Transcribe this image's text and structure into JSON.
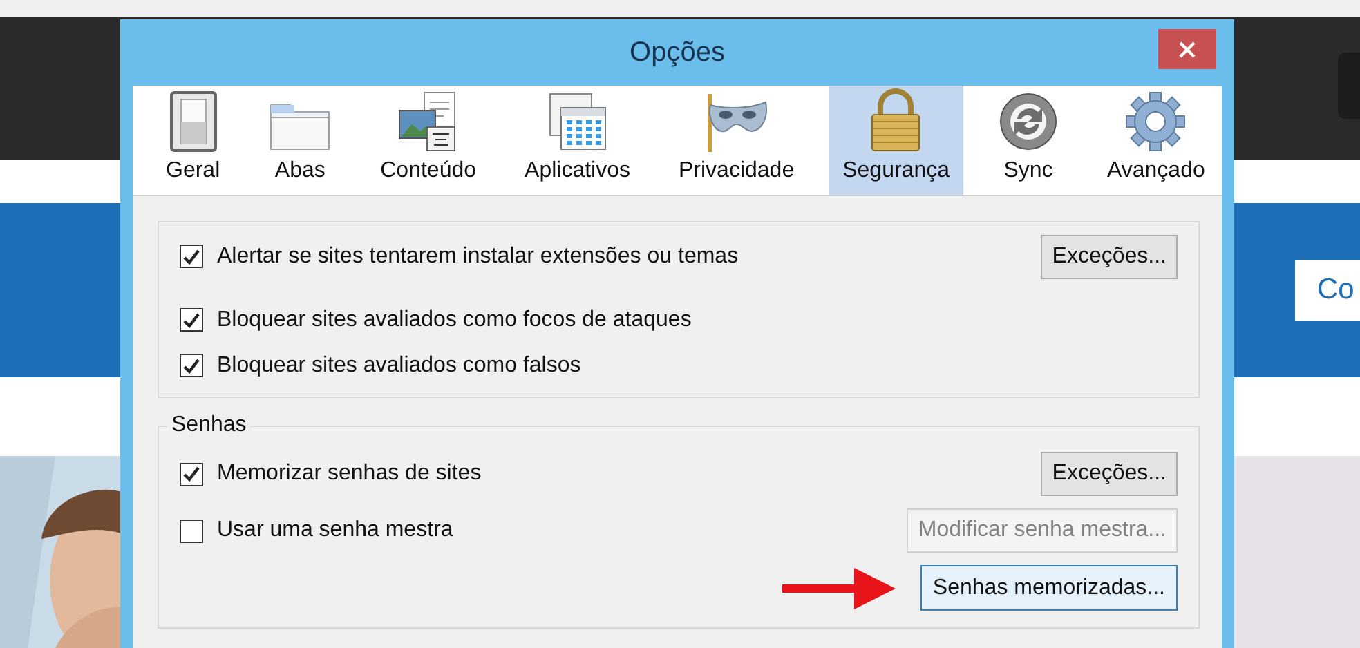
{
  "background": {
    "side_button": "Co"
  },
  "dialog": {
    "title": "Opções",
    "tabs": [
      {
        "label": "Geral",
        "kind": "general",
        "selected": false
      },
      {
        "label": "Abas",
        "kind": "tabs",
        "selected": false
      },
      {
        "label": "Conteúdo",
        "kind": "content",
        "selected": false
      },
      {
        "label": "Aplicativos",
        "kind": "applications",
        "selected": false
      },
      {
        "label": "Privacidade",
        "kind": "privacy",
        "selected": false
      },
      {
        "label": "Segurança",
        "kind": "security",
        "selected": true
      },
      {
        "label": "Sync",
        "kind": "sync",
        "selected": false
      },
      {
        "label": "Avançado",
        "kind": "advanced",
        "selected": false
      }
    ],
    "security_group": {
      "rows": [
        {
          "label": "Alertar se sites tentarem instalar extensões ou temas",
          "checked": true,
          "button": {
            "label": "Exceções...",
            "disabled": false
          }
        },
        {
          "label": "Bloquear sites avaliados como focos de ataques",
          "checked": true
        },
        {
          "label": "Bloquear sites avaliados como falsos",
          "checked": true
        }
      ]
    },
    "passwords_group": {
      "title": "Senhas",
      "rows": [
        {
          "label": "Memorizar senhas de sites",
          "checked": true,
          "button": {
            "label": "Exceções...",
            "disabled": false
          }
        },
        {
          "label": "Usar uma senha mestra",
          "checked": false,
          "button": {
            "label": "Modificar senha mestra...",
            "disabled": true
          }
        }
      ],
      "saved_button": {
        "label": "Senhas memorizadas...",
        "highlighted": true
      }
    }
  }
}
